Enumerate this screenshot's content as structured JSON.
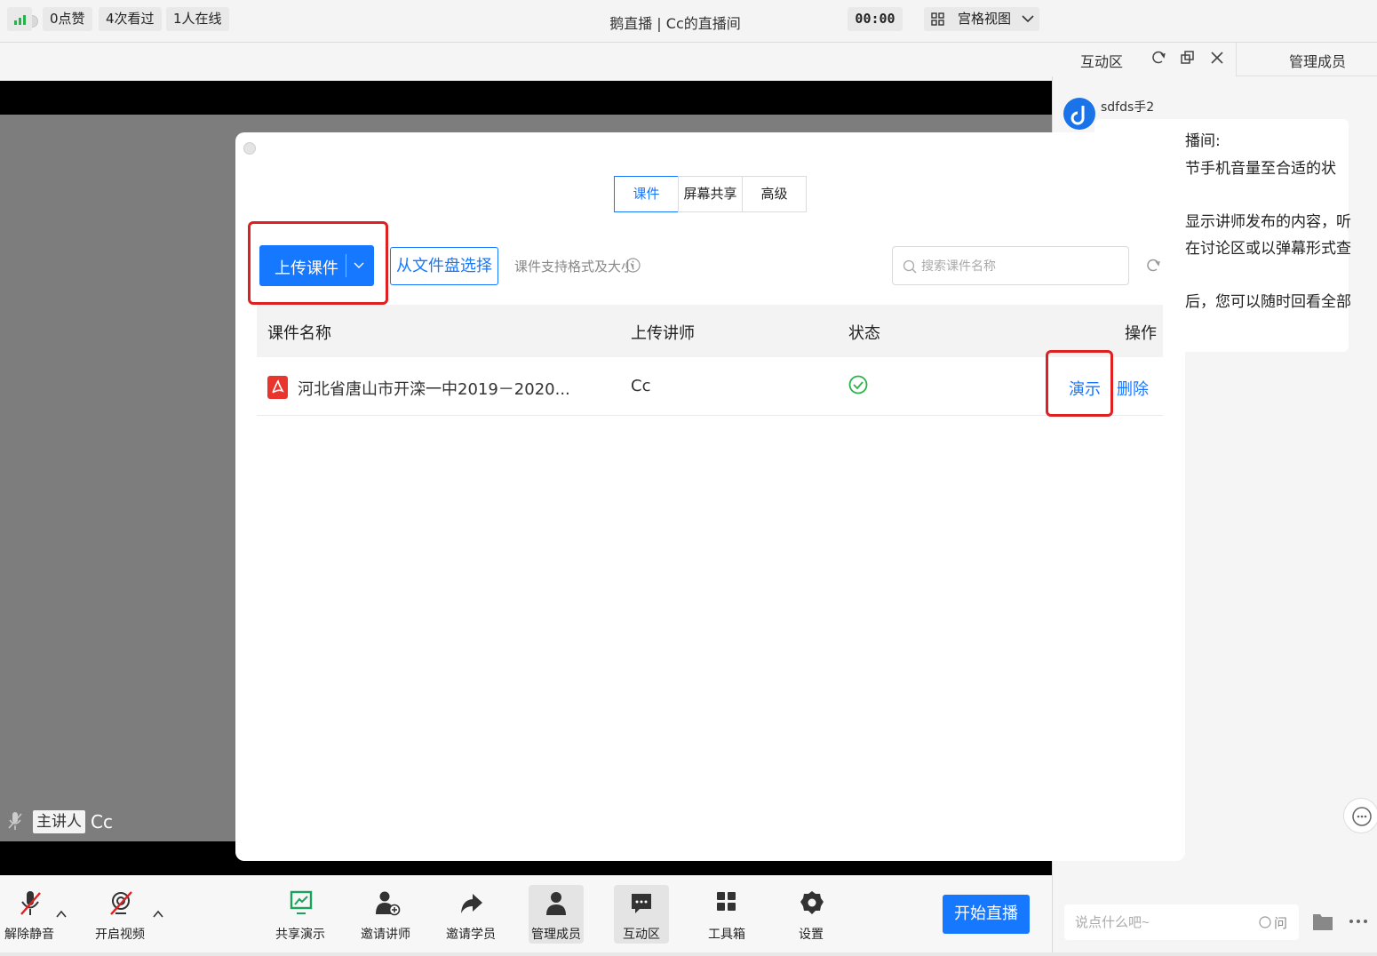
{
  "window": {
    "title": "鹅直播 | Cc的直播间"
  },
  "status": {
    "likes": "0点赞",
    "views": "4次看过",
    "online": "1人在线",
    "timer": "00:00",
    "view_mode": "宫格视图"
  },
  "video": {
    "role_tag": "主讲人",
    "presenter_name": "Cc"
  },
  "right_panel": {
    "tab_interaction": "互动区",
    "tab_members": "管理成员",
    "chat_user": "sdfds手2",
    "chat_lines": [
      "播间:",
      "节手机音量至合适的状",
      "显示讲师发布的内容，听",
      "在讨论区或以弹幕形式查",
      "后，您可以随时回看全部"
    ],
    "input_placeholder": "说点什么吧~",
    "ask_label": "问"
  },
  "modal": {
    "tabs": [
      "课件",
      "屏幕共享",
      "高级"
    ],
    "upload_label": "上传课件",
    "from_disk_label": "从文件盘选择",
    "format_hint": "课件支持格式及大小",
    "search_placeholder": "搜索课件名称",
    "columns": [
      "课件名称",
      "上传讲师",
      "状态",
      "操作"
    ],
    "rows": [
      {
        "name": "河北省唐山市开滦一中2019－2020...",
        "teacher": "Cc",
        "status": "ready",
        "actions": [
          "演示",
          "删除"
        ]
      }
    ]
  },
  "toolbar": {
    "unmute": "解除静音",
    "start_video": "开启视频",
    "share": "共享演示",
    "invite_teacher": "邀请讲师",
    "invite_student": "邀请学员",
    "manage_members": "管理成员",
    "interaction": "互动区",
    "toolbox": "工具箱",
    "settings": "设置",
    "start_live": "开始直播"
  },
  "colors": {
    "accent": "#1677ff",
    "highlight": "#e02020",
    "success": "#26b34a",
    "pdf": "#e8362f"
  },
  "icons": [
    "signal-icon",
    "grid-view-icon",
    "chevron-down-icon",
    "refresh-icon",
    "popout-icon",
    "close-icon",
    "search-icon",
    "info-icon",
    "pdf-file-icon",
    "check-circle-icon",
    "mic-muted-icon",
    "camera-off-icon",
    "share-screen-icon",
    "invite-teacher-icon",
    "share-arrow-icon",
    "members-icon",
    "chat-icon",
    "toolbox-icon",
    "gear-icon",
    "folder-icon",
    "more-icon"
  ]
}
